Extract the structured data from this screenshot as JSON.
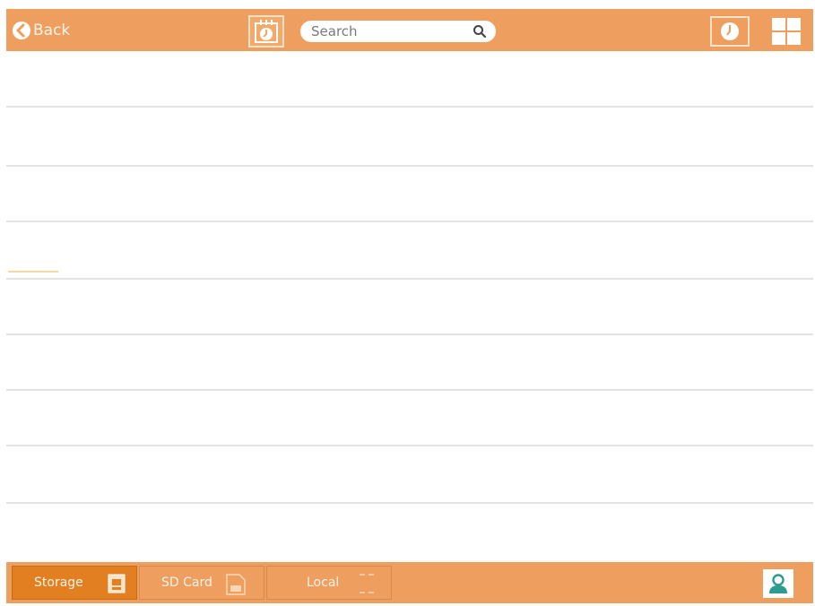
{
  "header": {
    "back_label": "Back",
    "search_placeholder": "Search",
    "icons": {
      "back": "back-arrow-icon",
      "calendar": "calendar-clock-icon",
      "search": "search-icon",
      "history": "clock-icon",
      "view": "grid-view-icon"
    }
  },
  "footer": {
    "tabs": [
      {
        "label": "Storage",
        "icon": "storage-icon",
        "active": true
      },
      {
        "label": "SD Card",
        "icon": "sd-card-icon",
        "active": false
      },
      {
        "label": "Local",
        "icon": "local-icon",
        "active": false
      }
    ],
    "user_icon": "user-icon"
  },
  "list": {
    "row_count": 9
  },
  "colors": {
    "bar": "#ee9f5f",
    "active_tab": "#e27f21",
    "divider": "#e2e2e2",
    "focus_mark": "#f5d9a2",
    "user_icon": "#2e9b8f"
  }
}
